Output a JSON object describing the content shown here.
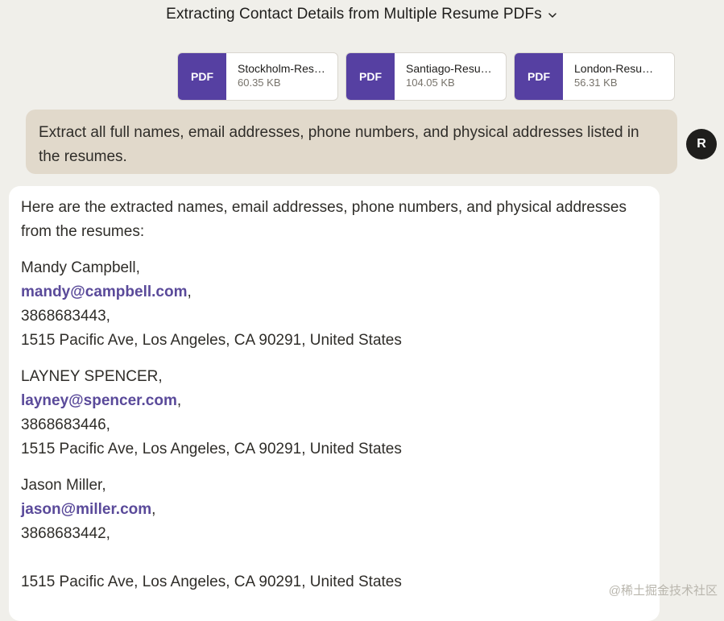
{
  "header": {
    "title": "Extracting Contact Details from Multiple Resume PDFs",
    "chevron_icon": "chevron-down-icon"
  },
  "attachments": [
    {
      "badge": "PDF",
      "name": "Stockholm-Resume.pdf",
      "size": "60.35 KB"
    },
    {
      "badge": "PDF",
      "name": "Santiago-Resume.pdf",
      "size": "104.05 KB"
    },
    {
      "badge": "PDF",
      "name": "London-Resume.pdf",
      "size": "56.31 KB"
    }
  ],
  "user": {
    "avatar_initial": "R",
    "message": "Extract all full names, email addresses, phone numbers, and physical addresses listed in the resumes."
  },
  "response": {
    "intro": "Here are the extracted names, email addresses, phone numbers, and physical addresses from the resumes:",
    "contacts": [
      {
        "name": "Mandy Campbell,",
        "email": "mandy@campbell.com",
        "phone": "3868683443,",
        "address": "1515 Pacific Ave, Los Angeles, CA 90291, United States"
      },
      {
        "name": "LAYNEY SPENCER,",
        "email": "layney@spencer.com",
        "phone": "3868683446,",
        "address": "1515 Pacific Ave, Los Angeles, CA 90291, United States"
      },
      {
        "name": "Jason Miller,",
        "email": "jason@miller.com",
        "phone": "3868683442,",
        "address": "1515 Pacific Ave, Los Angeles, CA 90291, United States"
      }
    ],
    "email_separator": ","
  },
  "watermark": "@稀土掘金技术社区",
  "colors": {
    "background": "#f0efea",
    "accent": "#5640a2",
    "link": "#5a4a9a",
    "user_bubble": "#e1d9cb",
    "avatar": "#1f1e1c"
  }
}
